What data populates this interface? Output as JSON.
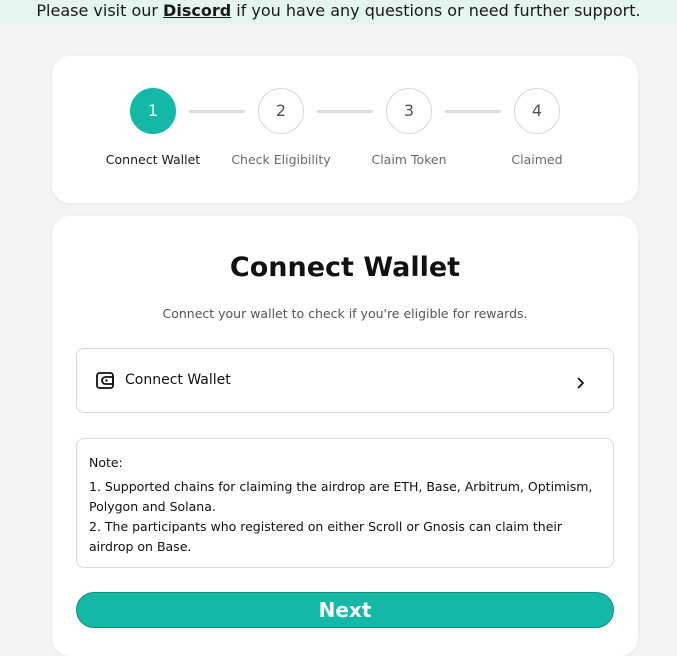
{
  "banner": {
    "prefix": "Please visit our ",
    "link": "Discord",
    "suffix": " if you have any questions or need further support."
  },
  "steps": [
    {
      "number": "1",
      "label": "Connect Wallet",
      "active": true
    },
    {
      "number": "2",
      "label": "Check Eligibility",
      "active": false
    },
    {
      "number": "3",
      "label": "Claim Token",
      "active": false
    },
    {
      "number": "4",
      "label": "Claimed",
      "active": false
    }
  ],
  "main": {
    "title": "Connect Wallet",
    "subtitle": "Connect your wallet to check if you're eligible for rewards.",
    "wallet_button_label": "Connect Wallet",
    "note_title": "Note:",
    "note_lines": [
      "1. Supported chains for claiming the airdrop are ETH, Base, Arbitrum, Optimism, Polygon and Solana.",
      "2. The participants who registered on either Scroll or Gnosis can claim their airdrop on Base."
    ],
    "next_label": "Next"
  },
  "colors": {
    "accent": "#14b8a6",
    "banner_bg": "#e3f4f1"
  },
  "icons": {
    "wallet": "wallet-icon",
    "chevron": "chevron-right-icon"
  }
}
